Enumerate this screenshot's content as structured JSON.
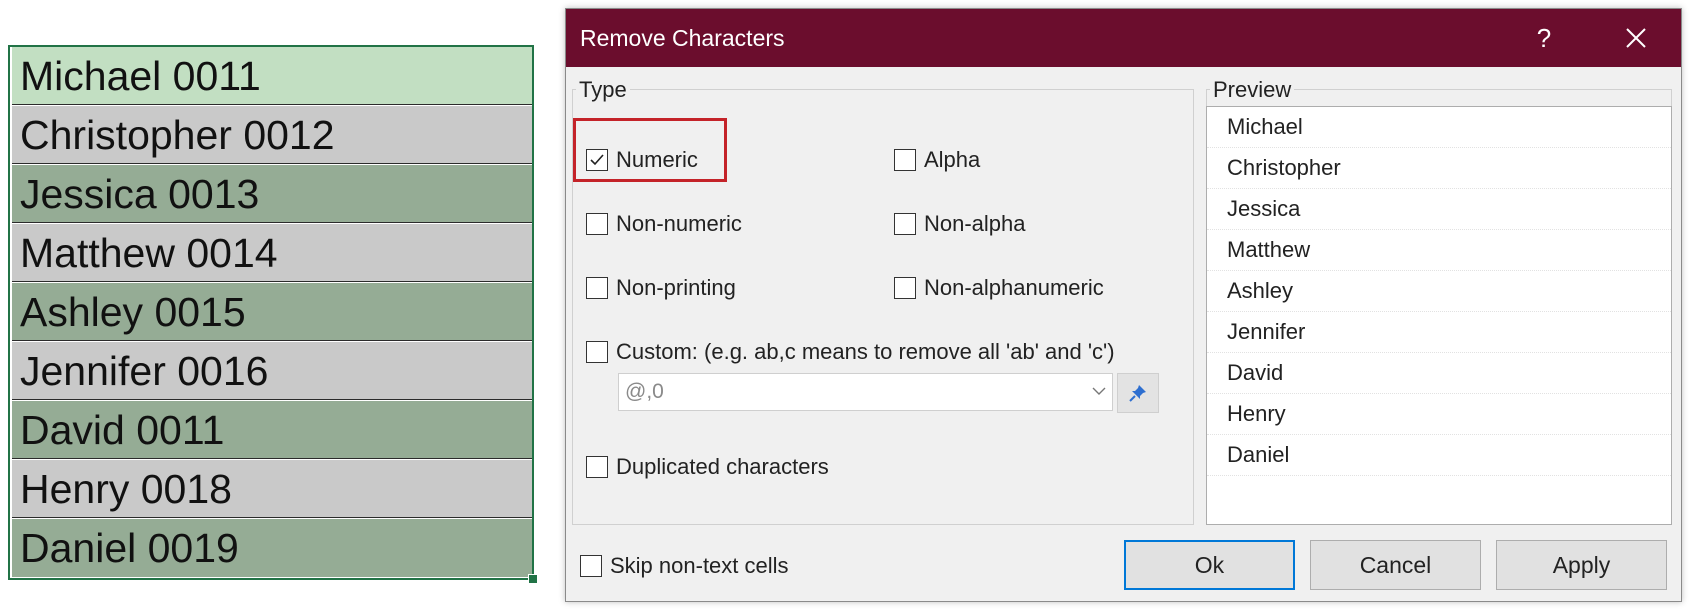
{
  "sheet": {
    "cells": [
      "Michael 0011",
      "Christopher 0012",
      "Jessica 0013",
      "Matthew 0014",
      "Ashley 0015",
      "Jennifer 0016",
      "David 0011",
      "Henry 0018",
      "Daniel 0019"
    ]
  },
  "dialog": {
    "title": "Remove Characters",
    "help": "?",
    "type_group": {
      "label": "Type",
      "options": {
        "numeric": {
          "label": "Numeric",
          "checked": true
        },
        "alpha": {
          "label": "Alpha",
          "checked": false
        },
        "non_numeric": {
          "label": "Non-numeric",
          "checked": false
        },
        "non_alpha": {
          "label": "Non-alpha",
          "checked": false
        },
        "non_printing": {
          "label": "Non-printing",
          "checked": false
        },
        "non_alphanumeric": {
          "label": "Non-alphanumeric",
          "checked": false
        },
        "custom": {
          "label": "Custom: (e.g. ab,c means to remove all 'ab' and 'c')",
          "checked": false
        },
        "duplicated": {
          "label": "Duplicated characters",
          "checked": false
        }
      },
      "custom_value": "@,0"
    },
    "preview": {
      "label": "Preview",
      "items": [
        "Michael",
        "Christopher",
        "Jessica",
        "Matthew",
        "Ashley",
        "Jennifer",
        "David",
        "Henry",
        "Daniel"
      ]
    },
    "skip_non_text": {
      "label": "Skip non-text cells",
      "checked": false
    },
    "buttons": {
      "ok": "Ok",
      "cancel": "Cancel",
      "apply": "Apply"
    },
    "colors": {
      "titlebar": "#6b0d2d",
      "highlight": "#c42329",
      "accent": "#0078d7"
    },
    "icons": {
      "close": "close-icon",
      "check": "checkmark-icon",
      "dropdown": "chevron-down-icon",
      "pin": "pin-icon"
    }
  }
}
